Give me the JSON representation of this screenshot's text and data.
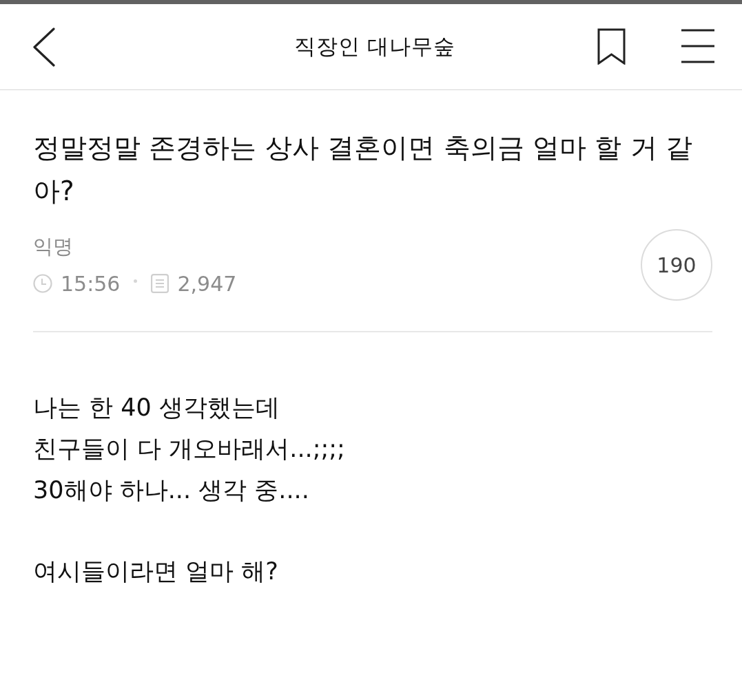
{
  "header": {
    "title": "직장인 대나무숲",
    "bookmarked": false
  },
  "post": {
    "title": "정말정말 존경하는 상사 결혼이면 축의금 얼마 할 거 같아?",
    "author": "익명",
    "time": "15:56",
    "views": "2,947",
    "count": "190",
    "paragraphs": [
      "나는 한 40 생각했는데\n친구들이 다 개오바래서...;;;;\n30해야 하나... 생각 중....",
      "여시들이라면 얼마 해?"
    ]
  }
}
